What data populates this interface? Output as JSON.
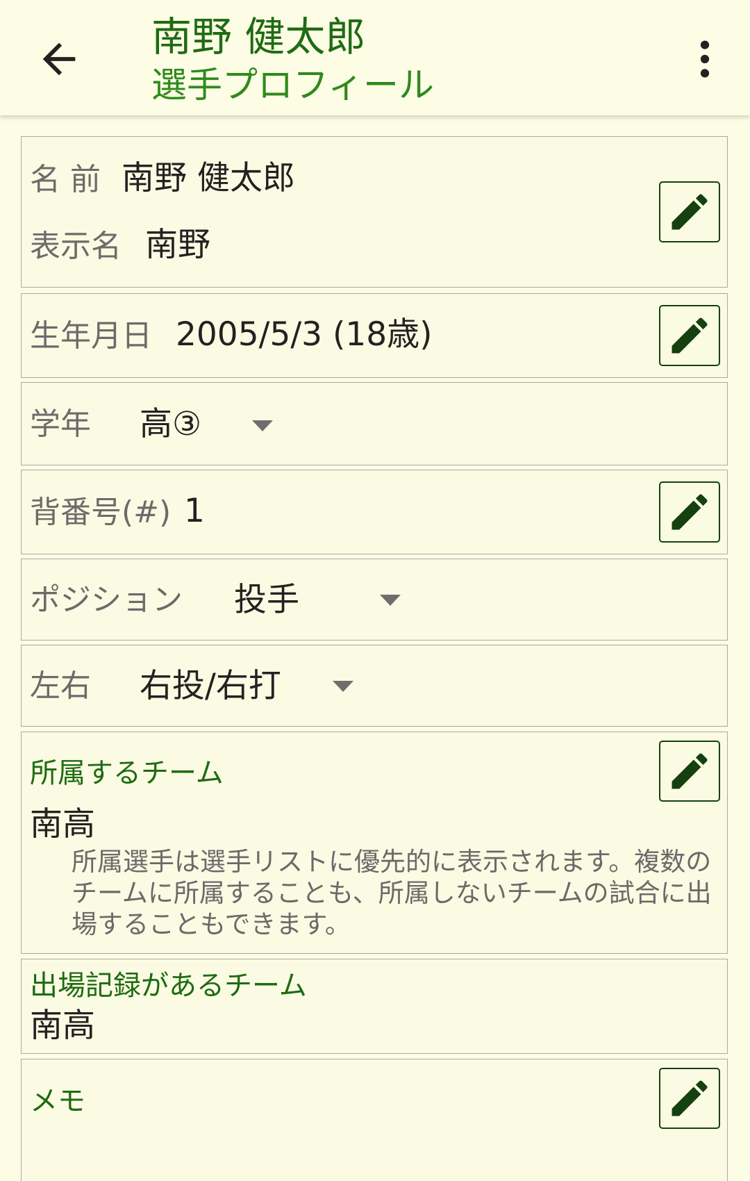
{
  "app_bar": {
    "title": "南野 健太郎",
    "subtitle": "選手プロフィール",
    "back_icon": "arrow-left-icon",
    "menu_icon": "more-vert-icon"
  },
  "name_card": {
    "name_label": "名 前",
    "name_value": "南野 健太郎",
    "display_label": "表示名",
    "display_value": "南野"
  },
  "birthday_card": {
    "label": "生年月日",
    "value": "2005/5/3 (18歳)"
  },
  "grade_card": {
    "label": "学年",
    "value": "高③"
  },
  "number_card": {
    "label": "背番号(#)",
    "value": "1"
  },
  "position_card": {
    "label": "ポジション",
    "value": "投手"
  },
  "handedness_card": {
    "label": "左右",
    "value": "右投/右打"
  },
  "team_card": {
    "title": "所属するチーム",
    "value": "南高",
    "note": "所属選手は選手リストに優先的に表示されます。複数のチームに所属することも、所属しないチームの試合に出場することもできます。"
  },
  "played_card": {
    "title": "出場記録があるチーム",
    "value": "南高"
  },
  "memo_card": {
    "title": "メモ",
    "value": ""
  },
  "icons": {
    "edit": "pencil-icon",
    "dropdown": "dropdown-arrow-icon"
  },
  "colors": {
    "background": "#fdfde6",
    "accent_green": "#1f6b12",
    "border": "#a9a9a0",
    "icon_green": "#154010"
  }
}
